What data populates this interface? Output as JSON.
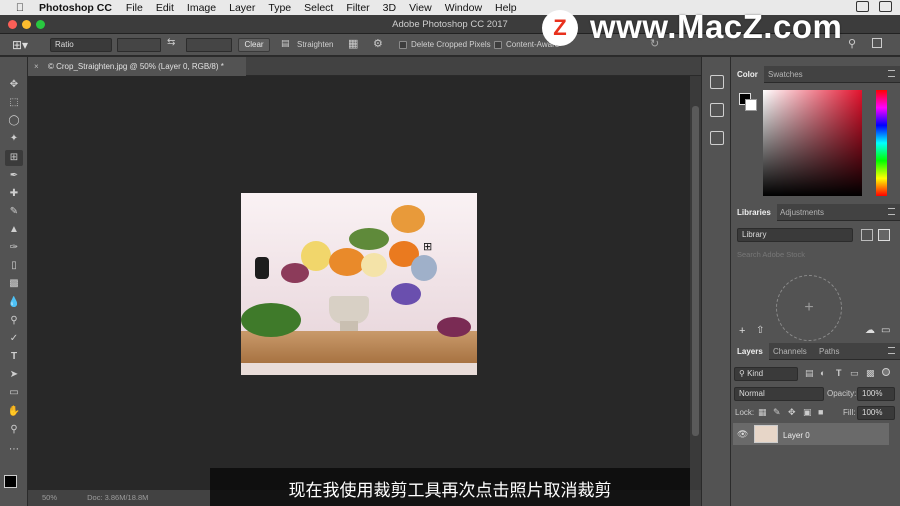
{
  "menubar": {
    "app_name": "Photoshop CC",
    "menus": [
      "File",
      "Edit",
      "Image",
      "Layer",
      "Type",
      "Select",
      "Filter",
      "3D",
      "View",
      "Window",
      "Help"
    ]
  },
  "window": {
    "title": "Adobe Photoshop CC 2017"
  },
  "options_bar": {
    "ratio_select": "Ratio",
    "clear_button": "Clear",
    "straighten_button": "Straighten",
    "delete_cropped_label": "Delete Cropped Pixels",
    "content_aware_label": "Content-Aware"
  },
  "document": {
    "tab_title": "© Crop_Straighten.jpg @ 50% (Layer 0, RGB/8) *"
  },
  "status_bar": {
    "zoom": "50%",
    "doc_size": "Doc: 3.86M/18.8M"
  },
  "color_panel": {
    "tabs": [
      "Color",
      "Swatches"
    ],
    "foreground": "#000000",
    "background": "#ffffff"
  },
  "libraries_panel": {
    "tabs": [
      "Libraries",
      "Adjustments"
    ],
    "library_select": "Library",
    "search_placeholder": "Search Adobe Stock"
  },
  "layers_panel": {
    "tabs": [
      "Layers",
      "Channels",
      "Paths"
    ],
    "filter_kind": "Kind",
    "blend_mode": "Normal",
    "opacity_label": "Opacity:",
    "opacity_value": "100%",
    "lock_label": "Lock:",
    "fill_label": "Fill:",
    "fill_value": "100%",
    "layers": [
      {
        "name": "Layer 0",
        "visible": true
      }
    ]
  },
  "watermark": {
    "logo_letter": "Z",
    "text": "www.MacZ.com"
  },
  "subtitle": "现在我使用裁剪工具再次点击照片取消裁剪"
}
